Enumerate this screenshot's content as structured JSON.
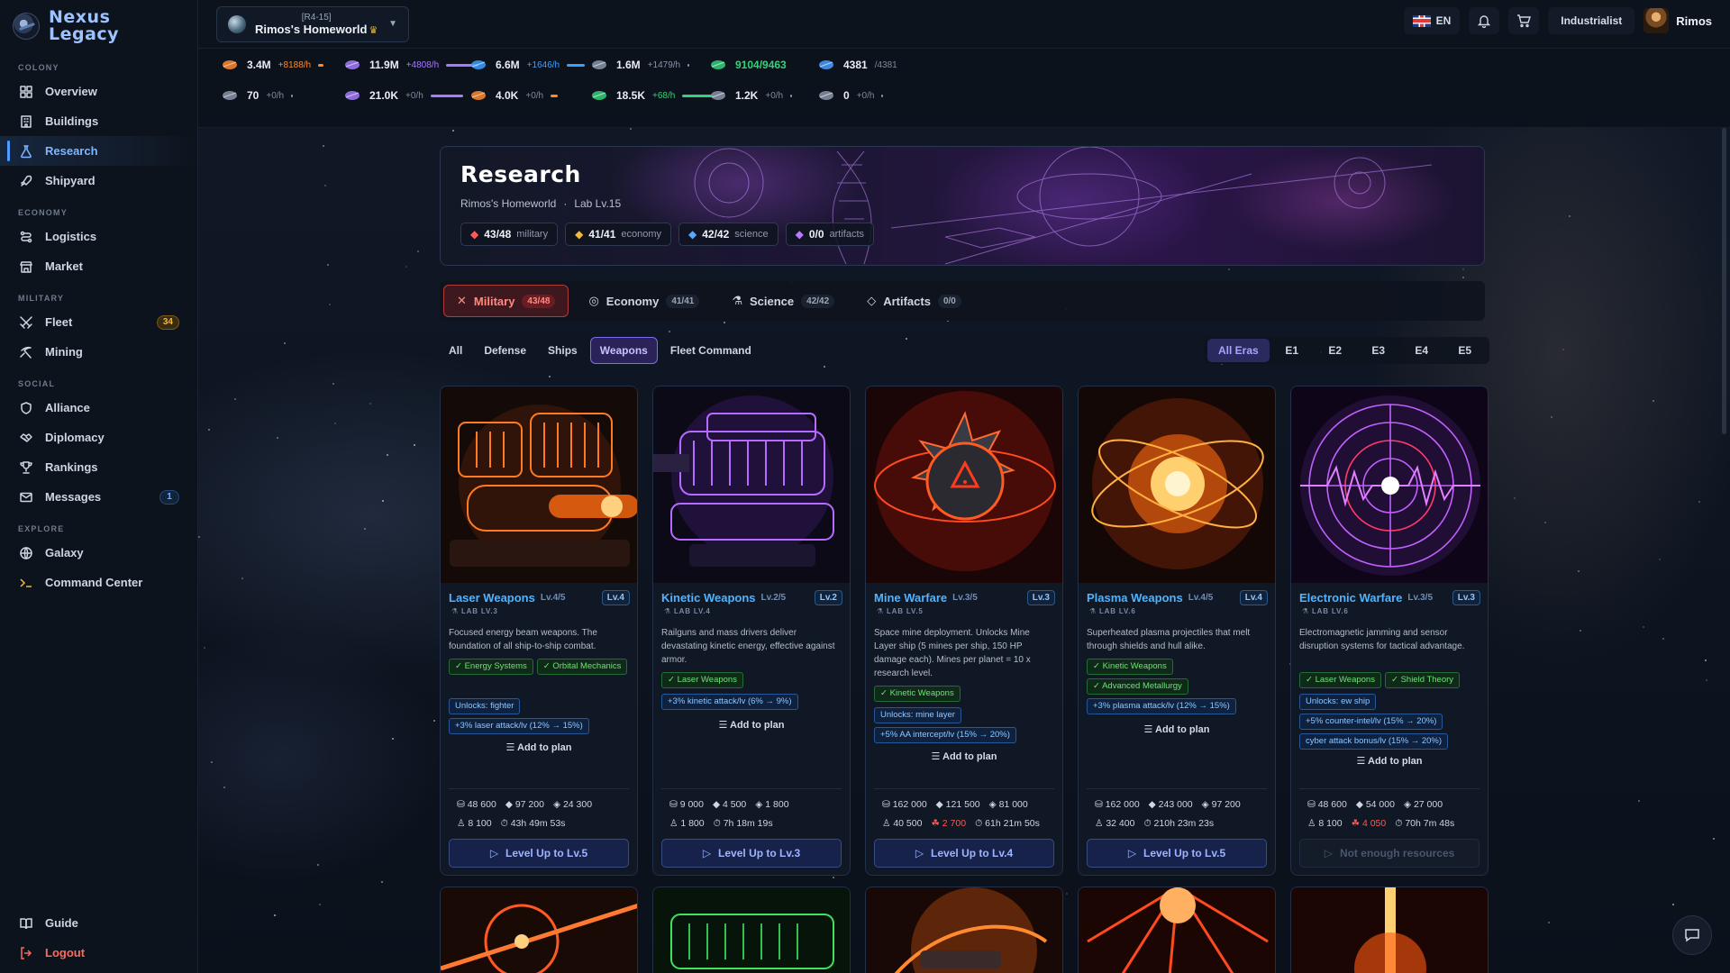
{
  "app": {
    "name_line1": "Nexus",
    "name_line2": "Legacy"
  },
  "sidebar": {
    "sections": [
      {
        "title": "COLONY",
        "items": [
          {
            "label": "Overview",
            "icon": "overview-icon"
          },
          {
            "label": "Buildings",
            "icon": "buildings-icon"
          },
          {
            "label": "Research",
            "icon": "flask-icon",
            "active": true
          },
          {
            "label": "Shipyard",
            "icon": "rocket-icon"
          }
        ]
      },
      {
        "title": "ECONOMY",
        "items": [
          {
            "label": "Logistics",
            "icon": "route-icon"
          },
          {
            "label": "Market",
            "icon": "store-icon"
          }
        ]
      },
      {
        "title": "MILITARY",
        "items": [
          {
            "label": "Fleet",
            "icon": "crossed-swords-icon",
            "badge": "34"
          },
          {
            "label": "Mining",
            "icon": "pickaxe-icon"
          }
        ]
      },
      {
        "title": "SOCIAL",
        "items": [
          {
            "label": "Alliance",
            "icon": "shield-icon"
          },
          {
            "label": "Diplomacy",
            "icon": "handshake-icon"
          },
          {
            "label": "Rankings",
            "icon": "trophy-icon"
          },
          {
            "label": "Messages",
            "icon": "mail-icon",
            "badge": "1"
          }
        ]
      },
      {
        "title": "EXPLORE",
        "items": [
          {
            "label": "Galaxy",
            "icon": "globe-icon"
          },
          {
            "label": "Command Center",
            "icon": "terminal-icon"
          }
        ]
      }
    ],
    "bottom": {
      "guide": "Guide",
      "logout": "Logout"
    }
  },
  "topbar": {
    "planet_coords": "[R4-15]",
    "planet_name": "Rimos's Homeworld",
    "language": "EN",
    "role": "Industrialist",
    "username": "Rimos"
  },
  "resources": [
    {
      "value": "3.4M",
      "rate": "+8188/h",
      "color": "#ff8a2a",
      "fill": 0.15
    },
    {
      "value": "11.9M",
      "rate": "+4808/h",
      "color": "#a67bff",
      "fill": 0.9
    },
    {
      "value": "6.6M",
      "rate": "+1646/h",
      "color": "#3aa0ff",
      "fill": 0.5
    },
    {
      "value": "1.6M",
      "rate": "+1479/h",
      "color": "#8a94a8",
      "fill": 0.05
    },
    {
      "value": "9104/9463",
      "rate": "",
      "color": "#34d17a"
    },
    {
      "value": "4381",
      "rate": "/4381",
      "color": "#4a9dff"
    },
    {
      "value": "70",
      "rate": "+0/h",
      "color": "#8a94a8",
      "fill": 0.02
    },
    {
      "value": "21.0K",
      "rate": "+0/h",
      "color": "#a67bff",
      "fill": 0.9
    },
    {
      "value": "4.0K",
      "rate": "+0/h",
      "color": "#ff8a2a",
      "fill": 0.2
    },
    {
      "value": "18.5K",
      "rate": "+68/h",
      "color": "#34d17a",
      "fill": 0.85
    },
    {
      "value": "1.2K",
      "rate": "+0/h",
      "color": "#8a94a8",
      "fill": 0.05
    },
    {
      "value": "0",
      "rate": "+0/h",
      "color": "#8a94a8",
      "fill": 0.0
    }
  ],
  "hero": {
    "title": "Research",
    "planet": "Rimos's Homeworld",
    "separator": "·",
    "lab": "Lab Lv.15",
    "stats": [
      {
        "value": "43/48",
        "label": "military",
        "color": "#ff5a5a"
      },
      {
        "value": "41/41",
        "label": "economy",
        "color": "#f1b83a"
      },
      {
        "value": "42/42",
        "label": "science",
        "color": "#5aa8ff"
      },
      {
        "value": "0/0",
        "label": "artifacts",
        "color": "#b779ff"
      }
    ]
  },
  "category_tabs": [
    {
      "label": "Military",
      "count": "43/48",
      "active": true
    },
    {
      "label": "Economy",
      "count": "41/41"
    },
    {
      "label": "Science",
      "count": "42/42"
    },
    {
      "label": "Artifacts",
      "count": "0/0"
    }
  ],
  "sub_tabs": [
    {
      "label": "All"
    },
    {
      "label": "Defense"
    },
    {
      "label": "Ships"
    },
    {
      "label": "Weapons",
      "active": true
    },
    {
      "label": "Fleet Command"
    }
  ],
  "era_tabs": [
    {
      "label": "All Eras",
      "active": true
    },
    {
      "label": "E1"
    },
    {
      "label": "E2"
    },
    {
      "label": "E3"
    },
    {
      "label": "E4"
    },
    {
      "label": "E5"
    }
  ],
  "add_plan_label": "Add to plan",
  "cards": [
    {
      "title": "Laser Weapons",
      "level": "Lv.4/5",
      "badge": "Lv.4",
      "lab": "LAB LV.3",
      "desc": "Focused energy beam weapons. The foundation of all ship-to-ship combat.",
      "prereqs": [
        "Energy Systems",
        "Orbital Mechanics"
      ],
      "unlocks": [
        "Unlocks: fighter",
        "+3% laser attack/lv (12% → 15%)"
      ],
      "cost_row1": [
        "48 600",
        "97 200",
        "24 300"
      ],
      "cost_row2": [
        "8 100",
        "",
        "43h 49m 53s"
      ],
      "button": "Level Up to Lv.5",
      "disabled": false,
      "theme": "laser"
    },
    {
      "title": "Kinetic Weapons",
      "level": "Lv.2/5",
      "badge": "Lv.2",
      "lab": "LAB LV.4",
      "desc": "Railguns and mass drivers deliver devastating kinetic energy, effective against armor.",
      "prereqs": [
        "Laser Weapons"
      ],
      "unlocks": [
        "+3% kinetic attack/lv (6% → 9%)"
      ],
      "cost_row1": [
        "9 000",
        "4 500",
        "1 800"
      ],
      "cost_row2": [
        "1 800",
        "",
        "7h 18m 19s"
      ],
      "button": "Level Up to Lv.3",
      "disabled": false,
      "theme": "kinetic"
    },
    {
      "title": "Mine Warfare",
      "level": "Lv.3/5",
      "badge": "Lv.3",
      "lab": "LAB LV.5",
      "desc": "Space mine deployment. Unlocks Mine Layer ship (5 mines per ship, 150 HP damage each). Mines per planet = 10 x research level.",
      "prereqs": [
        "Kinetic Weapons"
      ],
      "unlocks": [
        "Unlocks: mine layer",
        "+5% AA intercept/lv (15% → 20%)"
      ],
      "cost_row1": [
        "162 000",
        "121 500",
        "81 000"
      ],
      "cost_row2": [
        "40 500",
        "2 700",
        "61h 21m 50s"
      ],
      "button": "Level Up to Lv.4",
      "disabled": false,
      "theme": "mine"
    },
    {
      "title": "Plasma Weapons",
      "level": "Lv.4/5",
      "badge": "Lv.4",
      "lab": "LAB LV.6",
      "desc": "Superheated plasma projectiles that melt through shields and hull alike.",
      "prereqs": [
        "Kinetic Weapons",
        "Advanced Metallurgy"
      ],
      "unlocks": [
        "+3% plasma attack/lv (12% → 15%)"
      ],
      "cost_row1": [
        "162 000",
        "243 000",
        "97 200"
      ],
      "cost_row2": [
        "32 400",
        "",
        "210h 23m 23s"
      ],
      "button": "Level Up to Lv.5",
      "disabled": false,
      "theme": "plasma"
    },
    {
      "title": "Electronic Warfare",
      "level": "Lv.3/5",
      "badge": "Lv.3",
      "lab": "LAB LV.6",
      "desc": "Electromagnetic jamming and sensor disruption systems for tactical advantage.",
      "prereqs": [
        "Laser Weapons",
        "Shield Theory"
      ],
      "unlocks": [
        "Unlocks: ew ship",
        "+5% counter-intel/lv (15% → 20%)",
        "cyber attack bonus/lv (15% → 20%)"
      ],
      "cost_row1": [
        "48 600",
        "54 000",
        "27 000"
      ],
      "cost_row2": [
        "8 100",
        "4 050",
        "70h 7m 48s"
      ],
      "button": "Not enough resources",
      "disabled": true,
      "theme": "ewar"
    }
  ]
}
